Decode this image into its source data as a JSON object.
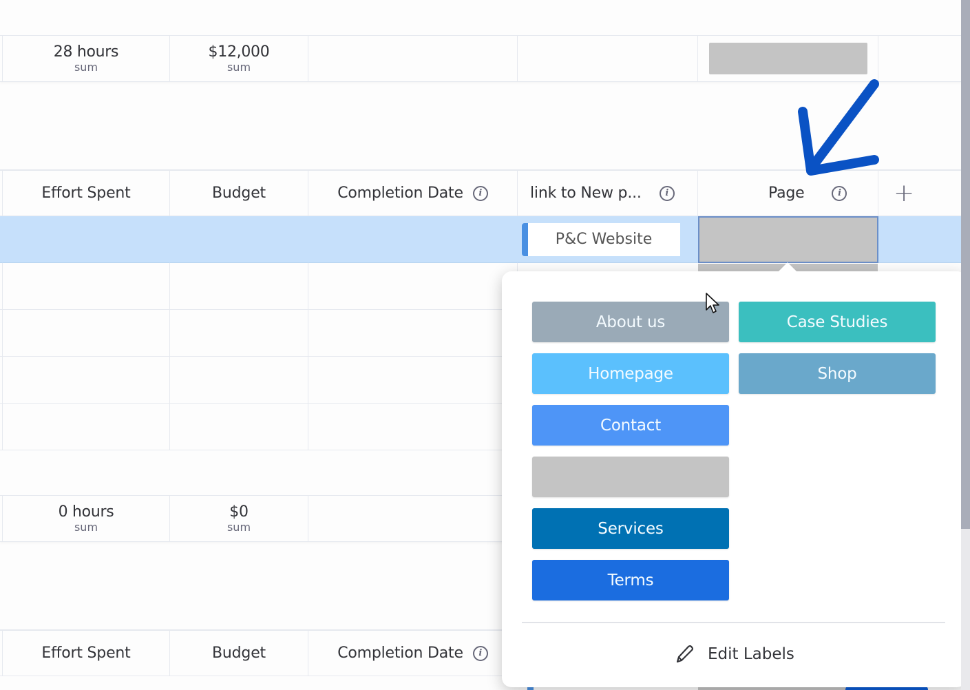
{
  "group1": {
    "summary": {
      "effort": {
        "value": "28 hours",
        "label": "sum"
      },
      "budget": {
        "value": "$12,000",
        "label": "sum"
      }
    }
  },
  "group2": {
    "columns": {
      "effort": "Effort Spent",
      "budget": "Budget",
      "completion": "Completion Date",
      "link": "link to New p...",
      "page": "Page",
      "add": "+"
    },
    "selected_row": {
      "link_value": "P&C Website",
      "page_value": ""
    },
    "summary": {
      "effort": {
        "value": "0 hours",
        "label": "sum"
      },
      "budget": {
        "value": "$0",
        "label": "sum"
      }
    }
  },
  "group3": {
    "columns": {
      "effort": "Effort Spent",
      "budget": "Budget",
      "completion": "Completion Date"
    }
  },
  "label_picker": {
    "labels": [
      {
        "name": "About us",
        "color": "#9aaab7"
      },
      {
        "name": "Case Studies",
        "color": "#3bbfbf"
      },
      {
        "name": "Homepage",
        "color": "#5bc0fd"
      },
      {
        "name": "Shop",
        "color": "#6aa8cb"
      },
      {
        "name": "Contact",
        "color": "#4e95f7"
      },
      {
        "name": "",
        "color": "#c4c4c4"
      },
      {
        "name": "Services",
        "color": "#0071b3"
      },
      {
        "name": "Terms",
        "color": "#1b6de0"
      }
    ],
    "edit_labels": "Edit Labels"
  },
  "colors": {
    "selected_row": "#c6e0fb",
    "annotation_arrow": "#0a52c4",
    "empty_label": "#c4c4c4"
  }
}
